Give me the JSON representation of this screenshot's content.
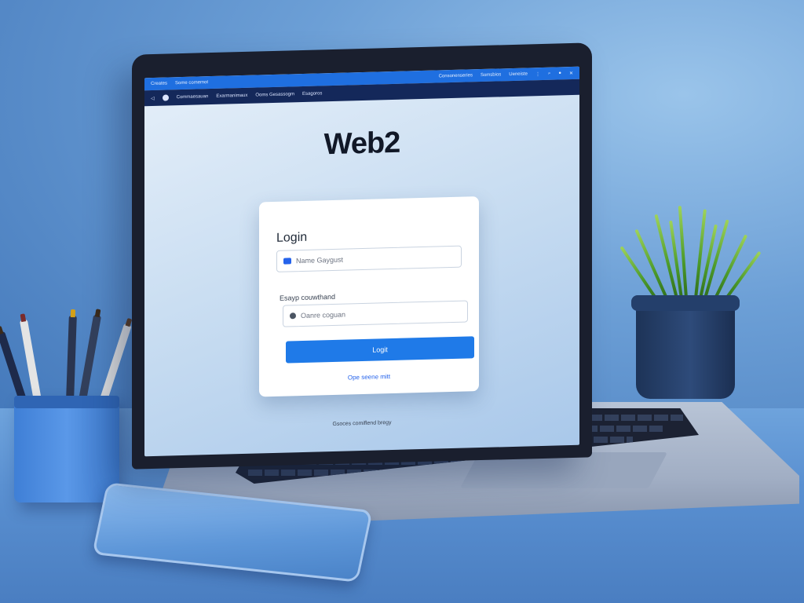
{
  "browser": {
    "top_bar": {
      "left_items": [
        "Creates",
        "Some comemot"
      ],
      "right_items": [
        "Consonenseries",
        "Somsbios",
        "Ueneiste"
      ],
      "window_controls": [
        "menu-icon",
        "search-icon",
        "account-icon",
        "close-icon"
      ]
    },
    "nav_bar": {
      "items": [
        "Commaesauan",
        "Exarmanimaux",
        "Ooms Gesassogm",
        "Esagoros"
      ]
    }
  },
  "page": {
    "brand_title": "Web2",
    "login_card": {
      "title": "Login",
      "username_field": {
        "placeholder": "Name Gaygust",
        "icon": "user-icon"
      },
      "password_label": "Esayp couwthand",
      "password_field": {
        "placeholder": "Oanre coguan",
        "icon": "lock-icon"
      },
      "login_button": "Logit",
      "forgot_link": "Ope seene mitt"
    },
    "footer_link": "Gsoces comiflend bregy"
  },
  "colors": {
    "accent": "#1f7ae8",
    "top_bar": "#1f6fe0",
    "nav_bar": "#14285a",
    "background": "#5d93d0"
  }
}
